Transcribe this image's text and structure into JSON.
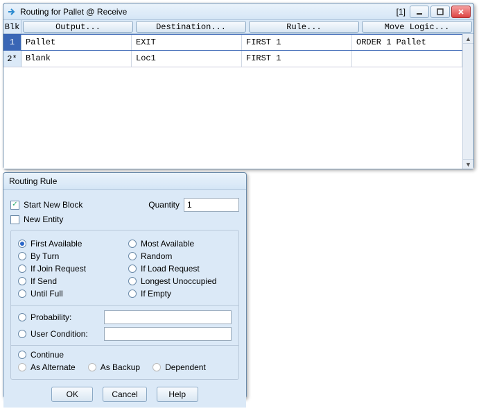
{
  "topWindow": {
    "title": "Routing for Pallet @ Receive",
    "instance": "[1]",
    "blkHeader": "Blk",
    "columns": [
      "Output...",
      "Destination...",
      "Rule...",
      "Move Logic..."
    ],
    "rows": [
      {
        "num": "1",
        "selected": true,
        "cells": [
          "Pallet",
          "EXIT",
          "FIRST 1",
          "ORDER 1 Pallet"
        ]
      },
      {
        "num": "2*",
        "selected": false,
        "cells": [
          "Blank",
          "Loc1",
          "FIRST 1",
          ""
        ]
      }
    ]
  },
  "ruleWindow": {
    "title": "Routing Rule",
    "startNewBlock": {
      "label": "Start New Block",
      "checked": true
    },
    "newEntity": {
      "label": "New Entity",
      "checked": false
    },
    "quantity": {
      "label": "Quantity",
      "value": "1"
    },
    "radiosLeft": [
      {
        "label": "First Available",
        "on": true
      },
      {
        "label": "By Turn",
        "on": false
      },
      {
        "label": "If Join Request",
        "on": false
      },
      {
        "label": "If Send",
        "on": false
      },
      {
        "label": "Until Full",
        "on": false
      }
    ],
    "radiosRight": [
      {
        "label": "Most Available",
        "on": false
      },
      {
        "label": "Random",
        "on": false
      },
      {
        "label": "If Load Request",
        "on": false
      },
      {
        "label": "Longest Unoccupied",
        "on": false
      },
      {
        "label": "If Empty",
        "on": false
      }
    ],
    "probability": {
      "label": "Probability:",
      "value": ""
    },
    "userCondition": {
      "label": "User Condition:",
      "value": ""
    },
    "continue": {
      "label": "Continue",
      "on": false
    },
    "alternate": {
      "label": "As Alternate"
    },
    "backup": {
      "label": "As Backup"
    },
    "dependent": {
      "label": "Dependent"
    },
    "buttons": {
      "ok": "OK",
      "cancel": "Cancel",
      "help": "Help"
    }
  }
}
